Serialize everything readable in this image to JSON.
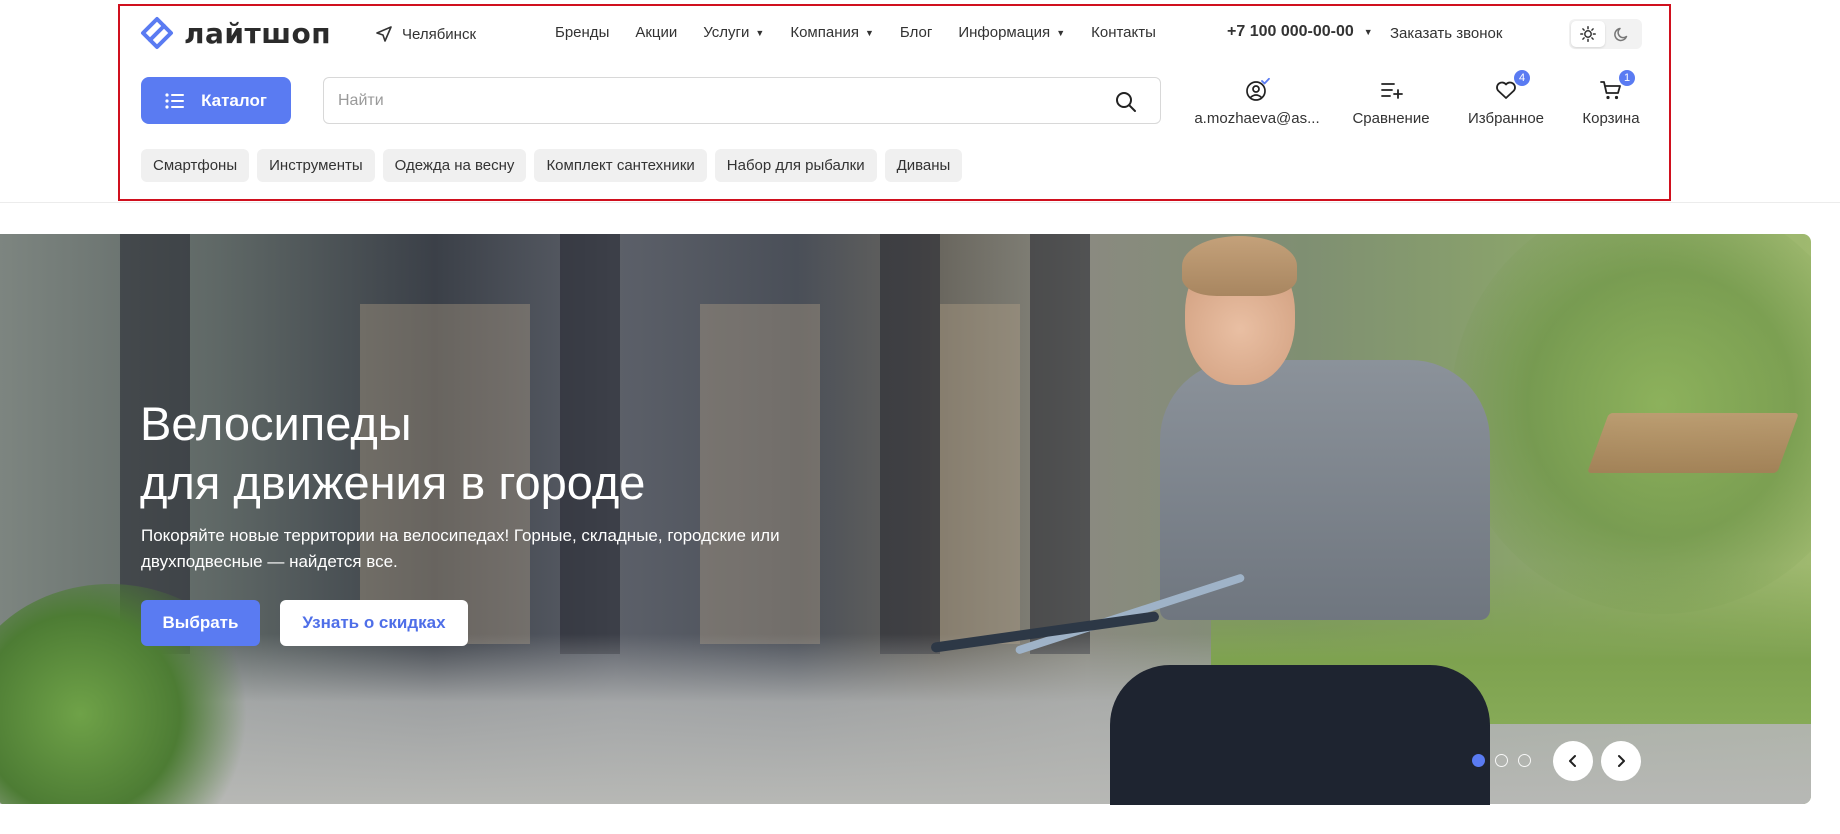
{
  "brand": {
    "name": "лайтшоп",
    "accent": "#5a7bf2"
  },
  "header": {
    "city": "Челябинск",
    "nav": [
      {
        "label": "Бренды",
        "dropdown": false
      },
      {
        "label": "Акции",
        "dropdown": false
      },
      {
        "label": "Услуги",
        "dropdown": true
      },
      {
        "label": "Компания",
        "dropdown": true
      },
      {
        "label": "Блог",
        "dropdown": false
      },
      {
        "label": "Информация",
        "dropdown": true
      },
      {
        "label": "Контакты",
        "dropdown": false
      }
    ],
    "phone": "+7 100 000-00-00",
    "callback": "Заказать звонок",
    "theme": {
      "active": "light"
    }
  },
  "toolbar": {
    "catalog_label": "Каталог",
    "search_placeholder": "Найти",
    "account_label": "a.mozhaeva@as...",
    "compare_label": "Сравнение",
    "favorites_label": "Избранное",
    "favorites_count": "4",
    "cart_label": "Корзина",
    "cart_count": "1"
  },
  "chips": [
    "Смартфоны",
    "Инструменты",
    "Одежда на весну",
    "Комплект сантехники",
    "Набор для рыбалки",
    "Диваны"
  ],
  "hero": {
    "title_line1": "Велосипеды",
    "title_line2": "для движения в городе",
    "subtitle": "Покоряйте новые территории на велосипедах! Горные, складные, городские или двухподвесные — найдется все.",
    "primary_btn": "Выбрать",
    "secondary_btn": "Узнать о скидках",
    "slides_total": 3,
    "slide_active": 1
  }
}
